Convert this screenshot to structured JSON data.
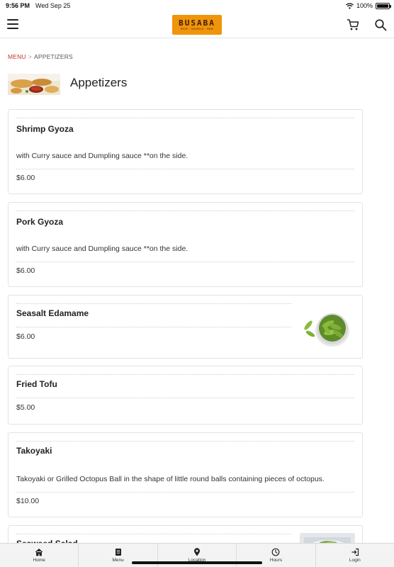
{
  "status_bar": {
    "time": "9:56 PM",
    "date": "Wed Sep 25",
    "battery_percent": "100%",
    "battery_level": 1.0
  },
  "header": {
    "logo_text": "BUSABA",
    "logo_subtext": "RICE · NOODLE · BAR",
    "menu_icon": "hamburger-icon",
    "cart_icon": "cart-icon",
    "search_icon": "search-icon",
    "brand_color": "#f0940b"
  },
  "breadcrumb": {
    "root": "MENU",
    "separator": ">",
    "current": "APPETIZERS"
  },
  "page": {
    "title": "Appetizers"
  },
  "items": [
    {
      "name": "Shrimp Gyoza",
      "description": "with Curry sauce and Dumpling sauce **on the side.",
      "price": "$6.00",
      "image": null
    },
    {
      "name": "Pork Gyoza",
      "description": "with Curry sauce and Dumpling sauce **on the side.",
      "price": "$6.00",
      "image": null
    },
    {
      "name": "Seasalt Edamame",
      "description": "",
      "price": "$6.00",
      "image": "edamame-photo"
    },
    {
      "name": "Fried Tofu",
      "description": "",
      "price": "$5.00",
      "image": null
    },
    {
      "name": "Takoyaki",
      "description": "Takoyaki or Grilled Octopus Ball in the shape of little round balls containing pieces of octopus.",
      "price": "$10.00",
      "image": null
    },
    {
      "name": "Seaweed Salad",
      "description": "",
      "price": "",
      "image": "seaweed-salad-photo"
    }
  ],
  "tab_bar": {
    "tabs": [
      {
        "label": "Home",
        "icon": "home-icon"
      },
      {
        "label": "Menu",
        "icon": "menu-book-icon"
      },
      {
        "label": "Location",
        "icon": "location-pin-icon"
      },
      {
        "label": "Hours",
        "icon": "clock-icon"
      },
      {
        "label": "Login",
        "icon": "login-icon"
      }
    ]
  }
}
